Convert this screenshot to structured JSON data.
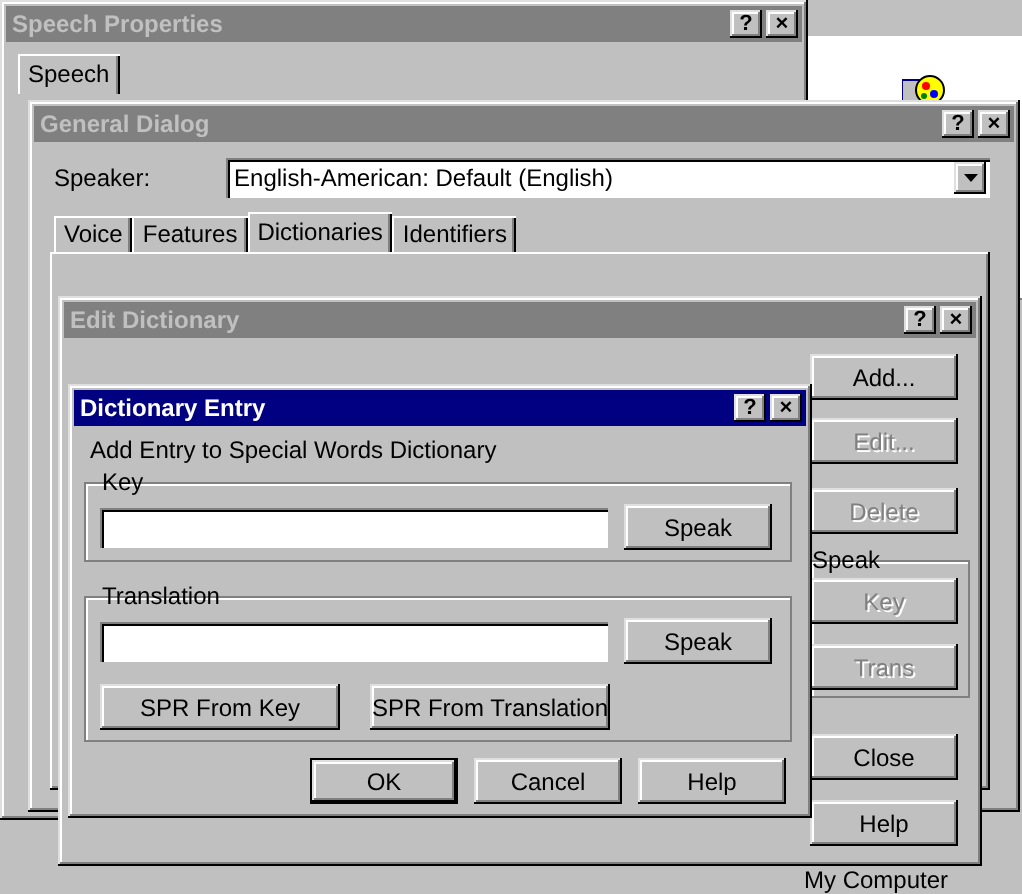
{
  "desktop": {
    "icon_label": "My Computer"
  },
  "speech_properties": {
    "title": "Speech Properties",
    "active": false,
    "title_buttons": [
      "?",
      "×"
    ],
    "tabs": [
      {
        "label": "Speech",
        "selected": true
      }
    ]
  },
  "general_dialog": {
    "title": "General Dialog",
    "active": false,
    "title_buttons": [
      "?",
      "×"
    ],
    "speaker_label": "Speaker:",
    "speaker_value": "English-American: Default (English)",
    "tabs": [
      {
        "label": "Voice",
        "selected": false
      },
      {
        "label": "Features",
        "selected": false
      },
      {
        "label": "Dictionaries",
        "selected": true
      },
      {
        "label": "Identifiers",
        "selected": false
      }
    ]
  },
  "edit_dictionary": {
    "title": "Edit Dictionary",
    "active": false,
    "title_buttons": [
      "?",
      "×"
    ],
    "buttons": [
      {
        "label": "Add...",
        "disabled": false
      },
      {
        "label": "Edit...",
        "disabled": true
      },
      {
        "label": "Delete",
        "disabled": true
      }
    ],
    "speak_group": {
      "label": "Speak",
      "buttons": [
        {
          "label": "Key",
          "disabled": true
        },
        {
          "label": "Trans",
          "disabled": true
        }
      ]
    },
    "bottom_buttons": [
      {
        "label": "Close",
        "disabled": false
      },
      {
        "label": "Help",
        "disabled": false
      }
    ]
  },
  "dictionary_entry": {
    "title": "Dictionary Entry",
    "active": true,
    "title_buttons": [
      "?",
      "×"
    ],
    "instruction": "Add Entry to Special Words Dictionary",
    "key_group": {
      "label": "Key",
      "speak": "Speak"
    },
    "translation_group": {
      "label": "Translation",
      "speak": "Speak",
      "buttons": [
        "SPR From Key",
        "SPR From Translation"
      ]
    },
    "buttons": [
      {
        "label": "OK",
        "default": true
      },
      {
        "label": "Cancel",
        "default": false
      },
      {
        "label": "Help",
        "default": false
      }
    ]
  }
}
